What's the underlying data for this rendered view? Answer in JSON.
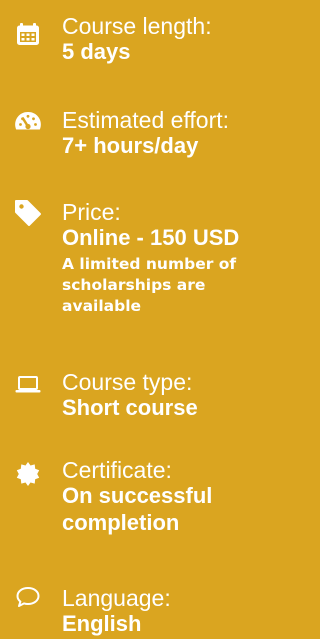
{
  "colors": {
    "background": "#DAA520",
    "text": "#FFFFFF"
  },
  "items": [
    {
      "icon": "calendar-icon",
      "label": "Course length:",
      "value": "5 days"
    },
    {
      "icon": "dashboard-gauge-icon",
      "label": "Estimated effort:",
      "value": "7+ hours/day"
    },
    {
      "icon": "price-tag-icon",
      "label": "Price:",
      "value": "Online - 150 USD",
      "note": "A limited number of scholarships are available"
    },
    {
      "icon": "laptop-icon",
      "label": "Course type:",
      "value": "Short course"
    },
    {
      "icon": "certificate-badge-icon",
      "label": "Certificate:",
      "value": "On successful completion"
    },
    {
      "icon": "speech-bubble-icon",
      "label": "Language:",
      "value": "English"
    }
  ]
}
